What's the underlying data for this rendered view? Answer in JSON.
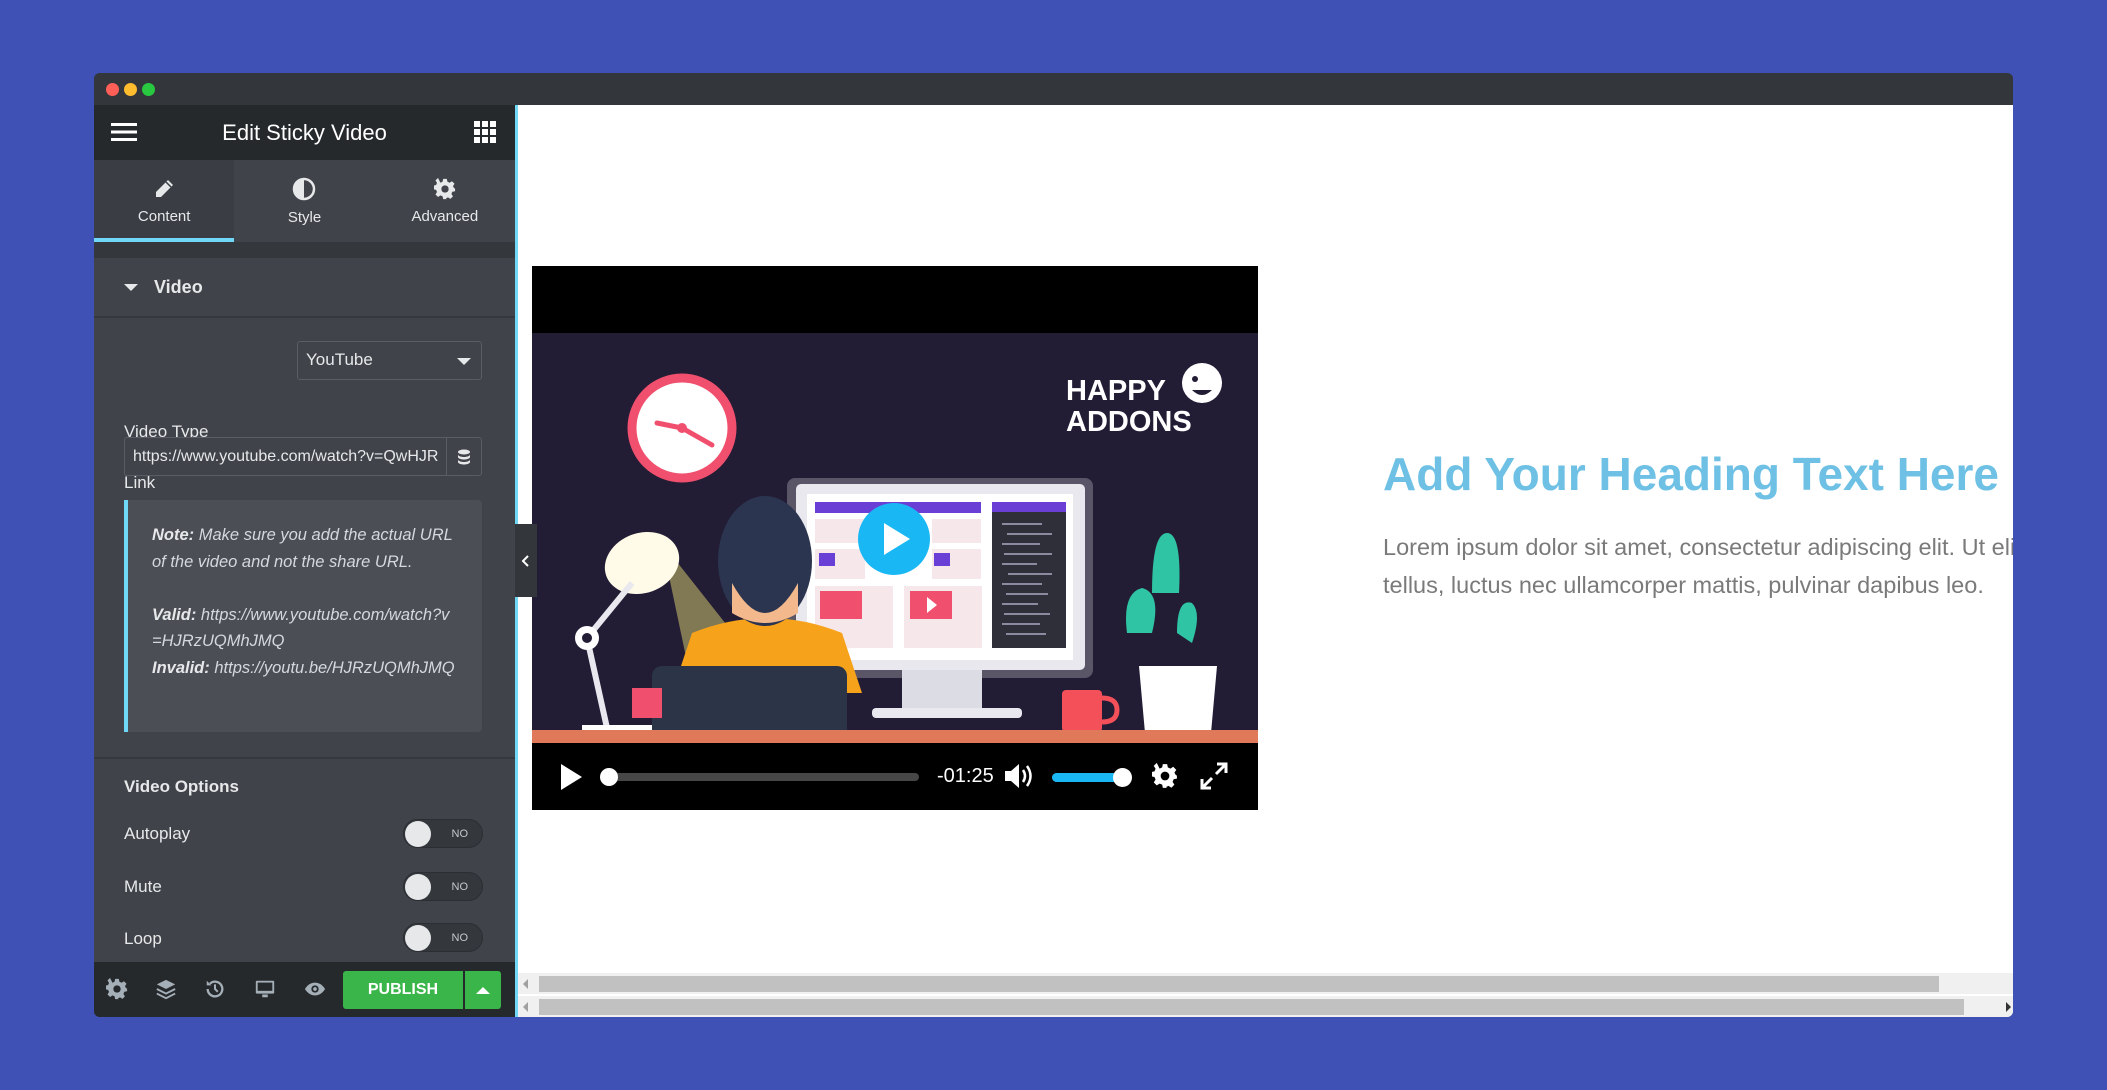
{
  "window": {
    "dots": [
      "#ff5f57",
      "#febc2e",
      "#28c840"
    ]
  },
  "sidebar": {
    "title": "Edit Sticky Video",
    "tabs": [
      {
        "label": "Content",
        "icon": "pencil-icon",
        "active": true
      },
      {
        "label": "Style",
        "icon": "half-circle-icon"
      },
      {
        "label": "Advanced",
        "icon": "gear-icon"
      }
    ],
    "section_title": "Video",
    "video_type_label": "Video Type",
    "video_type_value": "YouTube",
    "link_label": "Link",
    "link_value": "https://www.youtube.com/watch?v=QwHJRzUQMhJMQ",
    "note": {
      "note_label": "Note:",
      "note_text": " Make sure you add the actual URL of the video and not the share URL.",
      "valid_label": "Valid:",
      "valid_text": " https://www.youtube.com/watch?v=HJRzUQMhJMQ",
      "invalid_label": "Invalid:",
      "invalid_text": " https://youtu.be/HJRzUQMhJMQ"
    },
    "options_title": "Video Options",
    "options": [
      {
        "label": "Autoplay",
        "state": "NO"
      },
      {
        "label": "Mute",
        "state": "NO"
      },
      {
        "label": "Loop",
        "state": "NO"
      }
    ],
    "footer": {
      "publish_label": "PUBLISH",
      "publish_color": "#39b54a"
    }
  },
  "canvas": {
    "video": {
      "logo_line1": "HAPPY",
      "logo_line2": "ADDONS",
      "time_remaining": "-01:25",
      "progress": 0,
      "volume": 1.0,
      "accent": "#1ab7f5"
    },
    "heading": "Add Your Heading Text Here",
    "heading_color": "#6ec1e4",
    "paragraph": "Lorem ipsum dolor sit amet, consectetur adipiscing elit. Ut elit tellus, luctus nec ullamcorper mattis, pulvinar dapibus leo."
  }
}
